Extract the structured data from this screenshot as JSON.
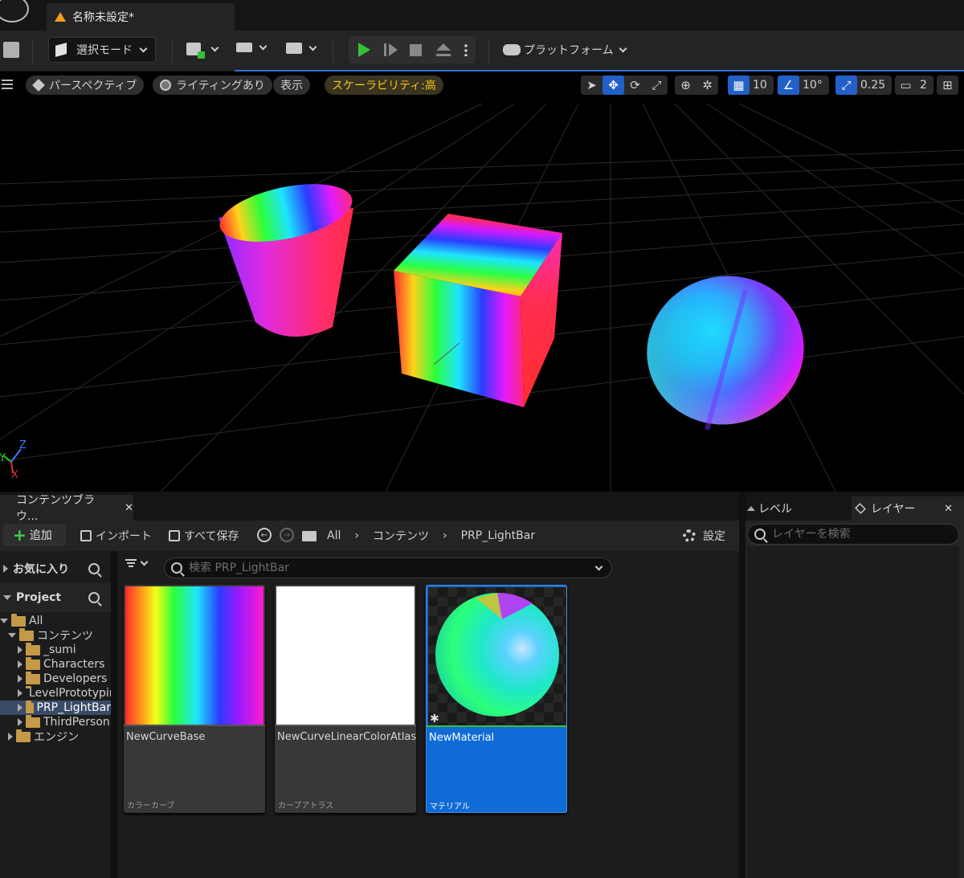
{
  "title_bar": {
    "doc_tab_label": "名称未設定*"
  },
  "toolbar": {
    "mode_label": "選択モード",
    "platform_label": "プラットフォーム"
  },
  "viewport": {
    "perspective_label": "パースペクティブ",
    "lighting_label": "ライティングあり",
    "show_label": "表示",
    "scalability_label": "スケーラビリティ:高",
    "grid_snap_value": "10",
    "rotation_snap_value": "10°",
    "scale_snap_value": "0.25",
    "camera_speed_value": "2",
    "axis_labels": {
      "z": "Z",
      "y": "Y",
      "x": "X"
    }
  },
  "content_browser": {
    "tab_label": "コンテンツブラウ...",
    "add_label": "追加",
    "import_label": "インポート",
    "save_all_label": "すべて保存",
    "breadcrumb": [
      "All",
      "コンテンツ",
      "PRP_LightBar"
    ],
    "settings_label": "設定",
    "favorites_label": "お気に入り",
    "project_label": "Project",
    "search_placeholder": "検索 PRP_LightBar",
    "tree": [
      {
        "label": "All",
        "depth": 0,
        "expanded": true
      },
      {
        "label": "コンテンツ",
        "depth": 1,
        "expanded": true
      },
      {
        "label": "_sumi",
        "depth": 2,
        "expanded": false
      },
      {
        "label": "Characters",
        "depth": 2,
        "expanded": false
      },
      {
        "label": "Developers",
        "depth": 2,
        "expanded": false
      },
      {
        "label": "LevelPrototyping",
        "depth": 2,
        "expanded": false
      },
      {
        "label": "PRP_LightBar",
        "depth": 2,
        "expanded": false,
        "selected": true
      },
      {
        "label": "ThirdPerson",
        "depth": 2,
        "expanded": false
      },
      {
        "label": "エンジン",
        "depth": 1,
        "expanded": false
      }
    ],
    "assets": [
      {
        "name": "NewCurveBase",
        "type": "カラーカーブ",
        "thumb": "rainbow"
      },
      {
        "name": "NewCurveLinearColorAtlas",
        "type": "カーブアトラス",
        "thumb": "white"
      },
      {
        "name": "NewMaterial",
        "type": "マテリアル",
        "thumb": "sphere",
        "selected": true
      }
    ]
  },
  "right_panel": {
    "level_tab_label": "レベル",
    "layer_tab_label": "レイヤー",
    "layer_search_placeholder": "レイヤーを検索"
  },
  "colors": {
    "accent_blue": "#0f6bd6",
    "play_green": "#36c236",
    "scalability_yellow": "#f5c518"
  }
}
